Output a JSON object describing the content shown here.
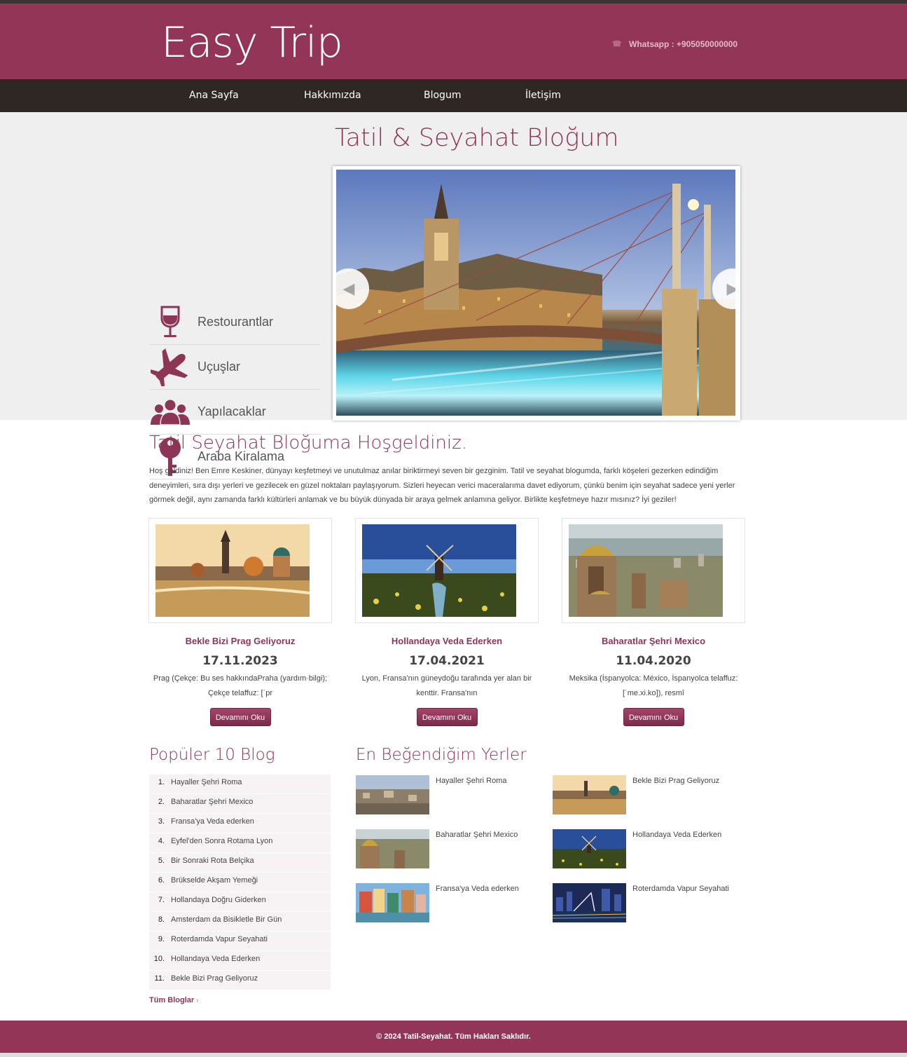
{
  "header": {
    "logo": "Easy Trip",
    "whatsapp": "Whatsapp : +905050000000",
    "phone_icon": "phone-icon"
  },
  "nav": {
    "items": [
      "Ana Sayfa",
      "Hakkımızda",
      "Blogum",
      "İletişim"
    ]
  },
  "hero": {
    "title": "Tatil & Seyahat Bloğum",
    "categories": [
      {
        "label": "Restourantlar",
        "icon": "wine-glass-icon"
      },
      {
        "label": "Uçuşlar",
        "icon": "airplane-icon"
      },
      {
        "label": "Yapılacaklar",
        "icon": "people-icon"
      },
      {
        "label": "Araba Kiralama",
        "icon": "key-icon"
      }
    ]
  },
  "welcome": {
    "title": "Tatil Seyahat Bloğuma Hoşgeldiniz.",
    "text": "Hoş geldiniz! Ben Emre Keskiner, dünyayı keşfetmeyi ve unutulmaz anılar biriktirmeyi seven bir gezginim. Tatil ve seyahat blogumda, farklı köşeleri gezerken edindiğim deneyimleri, sıra dışı yerleri ve gezilecek en güzel noktaları paylaşıyorum. Sizleri heyecan verici maceralarıma davet ediyorum, çünkü benim için seyahat sadece yeni yerler görmek değil, aynı zamanda farklı kültürleri anlamak ve bu büyük dünyada bir araya gelmek anlamına geliyor. Birlikte keşfetmeye hazır mısınız? İyi geziler!"
  },
  "cards": [
    {
      "title": "Bekle Bizi Prag Geliyoruz",
      "date": "17.11.2023",
      "excerpt": "Prag (Çekçe: Bu ses hakkındaPraha (yardım·bilgi); Çekçe telaffuz: [ˈpr",
      "button": "Devamını Oku"
    },
    {
      "title": "Hollandaya Veda Ederken",
      "date": "17.04.2021",
      "excerpt": "Lyon, Fransa'nın güneydoğu tarafında yer alan bir kenttir. Fransa'nın",
      "button": "Devamını Oku"
    },
    {
      "title": "Baharatlar Şehri Mexico",
      "date": "11.04.2020",
      "excerpt": "Meksika (İspanyolca: México, İspanyolca telaffuz: [ˈme.xi.ko]), resmî",
      "button": "Devamını Oku"
    }
  ],
  "popular": {
    "title": "Popüler 10 Blog",
    "items": [
      {
        "n": "1.",
        "t": "Hayaller Şehri Roma"
      },
      {
        "n": "2.",
        "t": "Baharatlar Şehri Mexico"
      },
      {
        "n": "3.",
        "t": "Fransa'ya Veda ederken"
      },
      {
        "n": "4.",
        "t": "Eyfel'den Sonra Rotama Lyon"
      },
      {
        "n": "5.",
        "t": "Bir Sonraki Rota Belçika"
      },
      {
        "n": "6.",
        "t": "Brükselde Akşam Yemeği"
      },
      {
        "n": "7.",
        "t": "Hollandaya Doğru Giderken"
      },
      {
        "n": "8.",
        "t": "Amsterdam da Bisikletle Bir Gün"
      },
      {
        "n": "9.",
        "t": "Roterdamda Vapur Seyahati"
      },
      {
        "n": "10.",
        "t": "Hollandaya Veda Ederken"
      },
      {
        "n": "11.",
        "t": "Bekle Bizi Prag Geliyoruz"
      }
    ],
    "all_link": "Tüm Bloglar"
  },
  "favorites": {
    "title": "En Beğendiğim Yerler",
    "items": [
      "Hayaller Şehri Roma",
      "Bekle Bizi Prag Geliyoruz",
      "Baharatlar Şehri Mexico",
      "Hollandaya Veda Ederken",
      "Fransa'ya Veda ederken",
      "Roterdamda Vapur Seyahati"
    ]
  },
  "footer": {
    "text": "© 2024 Tatil-Seyahat. Tüm Hakları Saklıdır."
  },
  "colors": {
    "brand": "#923557",
    "nav": "#2f2724",
    "hero_bg": "#efefef"
  }
}
